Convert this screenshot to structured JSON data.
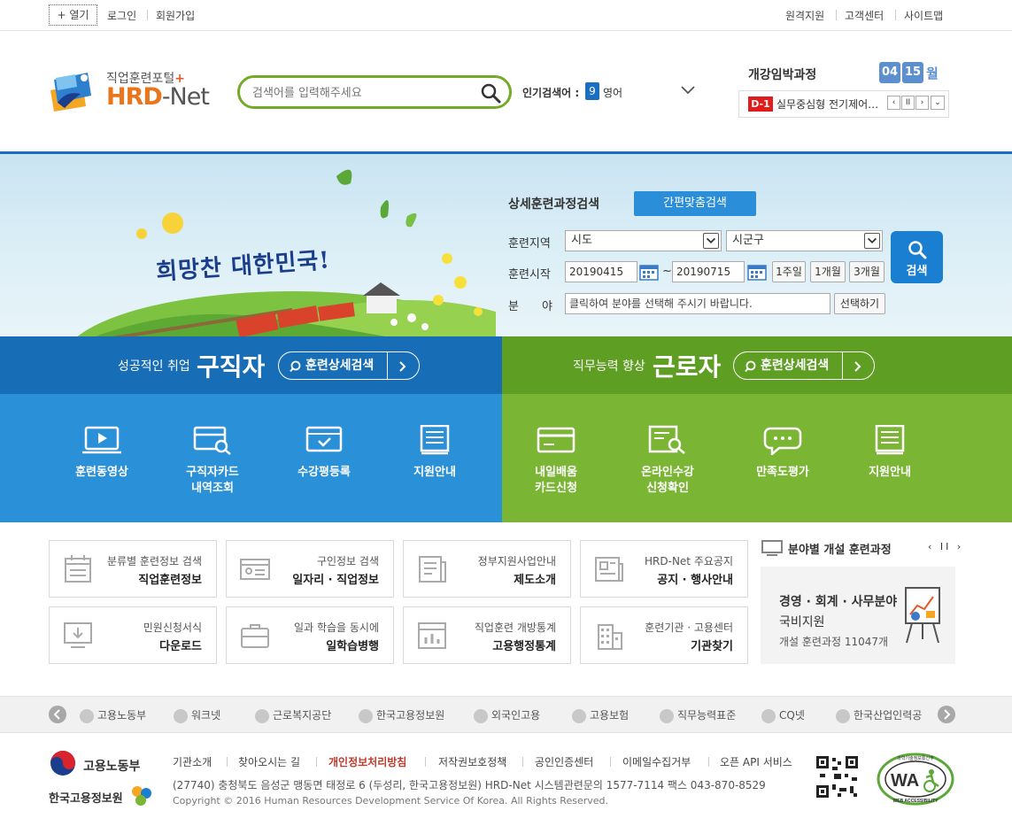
{
  "topbar": {
    "open_label": "+ 열기",
    "login": "로그인",
    "signup": "회원가입",
    "remote": "원격지원",
    "support": "고객센터",
    "sitemap": "사이트맵"
  },
  "logo": {
    "subtitle": "직업훈련포털",
    "plus": "+",
    "main_prefix": "HRD",
    "main_suffix": "-Net"
  },
  "search": {
    "placeholder": "검색어를 입력해주세요",
    "popular_label": "인기검색어 :",
    "popular_rank": "9",
    "popular_word": "영어"
  },
  "opening": {
    "title": "개강임박과정",
    "month": "04",
    "day": "15",
    "month_suffix": "월",
    "dday": "D-1",
    "course": "실무중심형 전기제어…"
  },
  "hero": {
    "slogan": "희망찬 대한민국!",
    "detail_title": "상세훈련과정검색",
    "quick_btn": "간편맞춤검색",
    "region_label": "훈련지역",
    "region_sido": "시도",
    "region_sigungu": "시군구",
    "start_label": "훈련시작",
    "date_from": "20190415",
    "tilde": "~",
    "date_to": "20190715",
    "period_1w": "1주일",
    "period_1m": "1개월",
    "period_3m": "3개월",
    "field_label_a": "분",
    "field_label_b": "야",
    "field_placeholder": "클릭하여 분야를 선택해 주시기 바랍니다.",
    "choose_btn": "선택하기",
    "search_btn": "검색"
  },
  "jobseeker": {
    "sub": "성공적인 취업",
    "title": "구직자",
    "btn": "훈련상세검색",
    "items": [
      {
        "line1": "훈련동영상",
        "line2": ""
      },
      {
        "line1": "구직자카드",
        "line2": "내역조회"
      },
      {
        "line1": "수강평등록",
        "line2": ""
      },
      {
        "line1": "지원안내",
        "line2": ""
      }
    ]
  },
  "worker": {
    "sub": "직무능력 향상",
    "title": "근로자",
    "btn": "훈련상세검색",
    "items": [
      {
        "line1": "내일배움",
        "line2": "카드신청"
      },
      {
        "line1": "온라인수강",
        "line2": "신청확인"
      },
      {
        "line1": "만족도평가",
        "line2": ""
      },
      {
        "line1": "지원안내",
        "line2": ""
      }
    ]
  },
  "quick": [
    {
      "top": "분류별 훈련정보 검색",
      "bottom": "직업훈련정보"
    },
    {
      "top": "구인정보 검색",
      "bottom": "일자리 · 직업정보"
    },
    {
      "top": "정부지원사업안내",
      "bottom": "제도소개"
    },
    {
      "top": "HRD-Net 주요공지",
      "bottom": "공지 · 행사안내"
    },
    {
      "top": "민원신청서식",
      "bottom": "다운로드"
    },
    {
      "top": "일과 학습을 동시에",
      "bottom": "일학습병행"
    },
    {
      "top": "직업훈련 개방통계",
      "bottom": "고용행정통계"
    },
    {
      "top": "훈련기관 · 고용센터",
      "bottom": "기관찾기"
    }
  ],
  "side": {
    "title": "분야별 개설 훈련과정",
    "controls": "‹ II ›",
    "field": "경영 · 회계 · 사무분야",
    "support": "국비지원",
    "count": "개설 훈련과정 11047개"
  },
  "partners": [
    "고용노동부",
    "워크넷",
    "근로복지공단",
    "한국고용정보원",
    "외국인고용",
    "고용보험",
    "직무능력표준",
    "CQ넷",
    "한국산업인력공"
  ],
  "footer": {
    "ministry": "고용노동부",
    "agency": "한국고용정보원",
    "links": [
      "기관소개",
      "찾아오시는 길",
      "개인정보처리방침",
      "저작권보호정책",
      "공인인증센터",
      "이메일수집거부",
      "오픈 API 서비스"
    ],
    "address": "(27740) 충청북도 음성군 맹동면 태정로 6 (두성리, 한국고용정보원) HRD-Net 시스템관련문의 1577-7114   팩스 043-870-8529",
    "copyright": "Copyright © 2016 Human Resources Development Service Of Korea. All Rights Reserved.",
    "wa_text": "WA",
    "wa_ring": "과학기술정보통신부",
    "wa_bottom": "WEB ACCESSIBILITY"
  },
  "colors": {
    "brand_blue": "#176db6",
    "brand_green": "#5e9e23",
    "accent_orange": "#e9751d",
    "search_border": "#74a92a"
  }
}
